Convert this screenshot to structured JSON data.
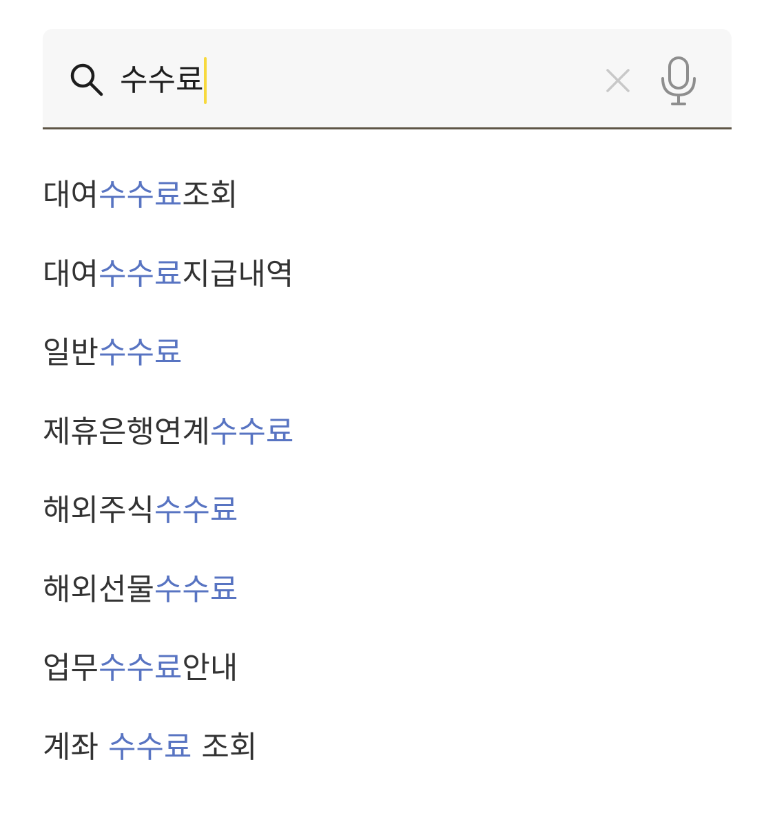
{
  "search": {
    "query": "수수료",
    "colors": {
      "field_background": "#f7f7f7",
      "underline": "#5e5546",
      "caret": "#f7d93e",
      "highlight": "#5874c2"
    }
  },
  "suggestions": [
    {
      "before": "대여",
      "match": "수수료",
      "after": "조회"
    },
    {
      "before": "대여",
      "match": "수수료",
      "after": "지급내역"
    },
    {
      "before": "일반",
      "match": "수수료",
      "after": ""
    },
    {
      "before": "제휴은행연계",
      "match": "수수료",
      "after": ""
    },
    {
      "before": "해외주식",
      "match": "수수료",
      "after": ""
    },
    {
      "before": "해외선물",
      "match": "수수료",
      "after": ""
    },
    {
      "before": "업무",
      "match": "수수료",
      "after": "안내"
    },
    {
      "before": "계좌 ",
      "match": "수수료",
      "after": " 조회"
    }
  ]
}
